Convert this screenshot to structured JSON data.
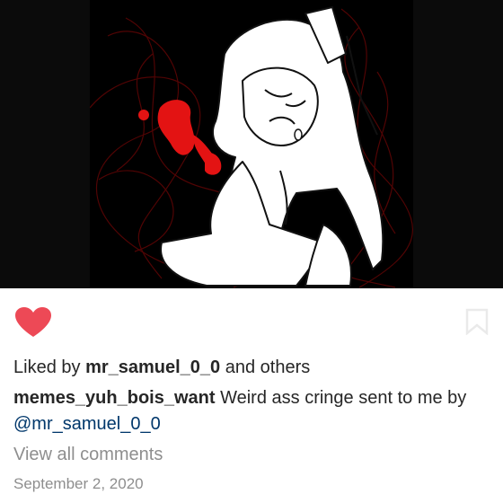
{
  "post": {
    "likes": {
      "prefix": "Liked by ",
      "user": "mr_samuel_0_0",
      "suffix": " and others"
    },
    "caption": {
      "author": "memes_yuh_bois_want",
      "text": " Weird ass cringe sent to me by ",
      "mention": "@mr_samuel_0_0"
    },
    "view_comments": "View all comments",
    "date": "September 2, 2020"
  },
  "icons": {
    "like": "heart-icon",
    "save": "bookmark-icon"
  },
  "colors": {
    "heart": "#ed4956",
    "mention": "#00376b",
    "muted": "#8e8e8e"
  }
}
